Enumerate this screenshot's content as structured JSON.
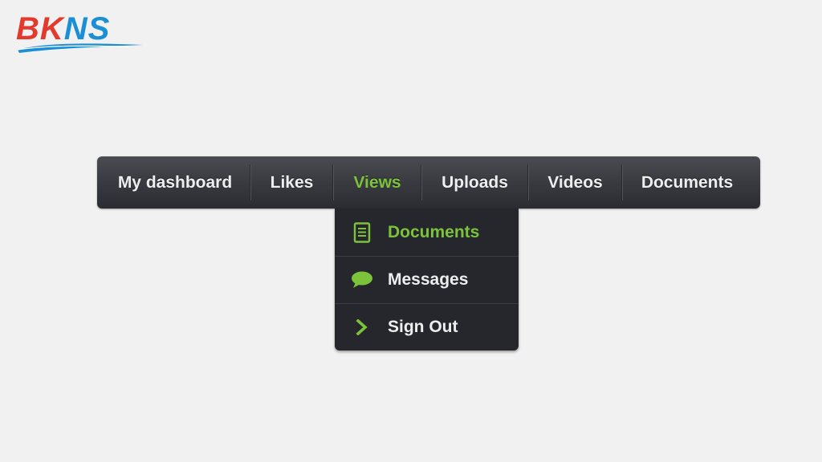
{
  "logo": {
    "text_part1": "BK",
    "text_part2": "NS",
    "colors": {
      "red": "#e23b2e",
      "blue": "#1b8fd6"
    }
  },
  "menu": {
    "items": [
      {
        "label": "My dashboard",
        "active": false
      },
      {
        "label": "Likes",
        "active": false
      },
      {
        "label": "Views",
        "active": true
      },
      {
        "label": "Uploads",
        "active": false
      },
      {
        "label": "Videos",
        "active": false
      },
      {
        "label": "Documents",
        "active": false
      }
    ],
    "accent_color": "#7cc33b"
  },
  "dropdown": {
    "items": [
      {
        "label": "Documents",
        "icon": "document-icon",
        "active": true
      },
      {
        "label": "Messages",
        "icon": "speech-bubble-icon",
        "active": false
      },
      {
        "label": "Sign Out",
        "icon": "chevron-right-icon",
        "active": false
      }
    ]
  }
}
